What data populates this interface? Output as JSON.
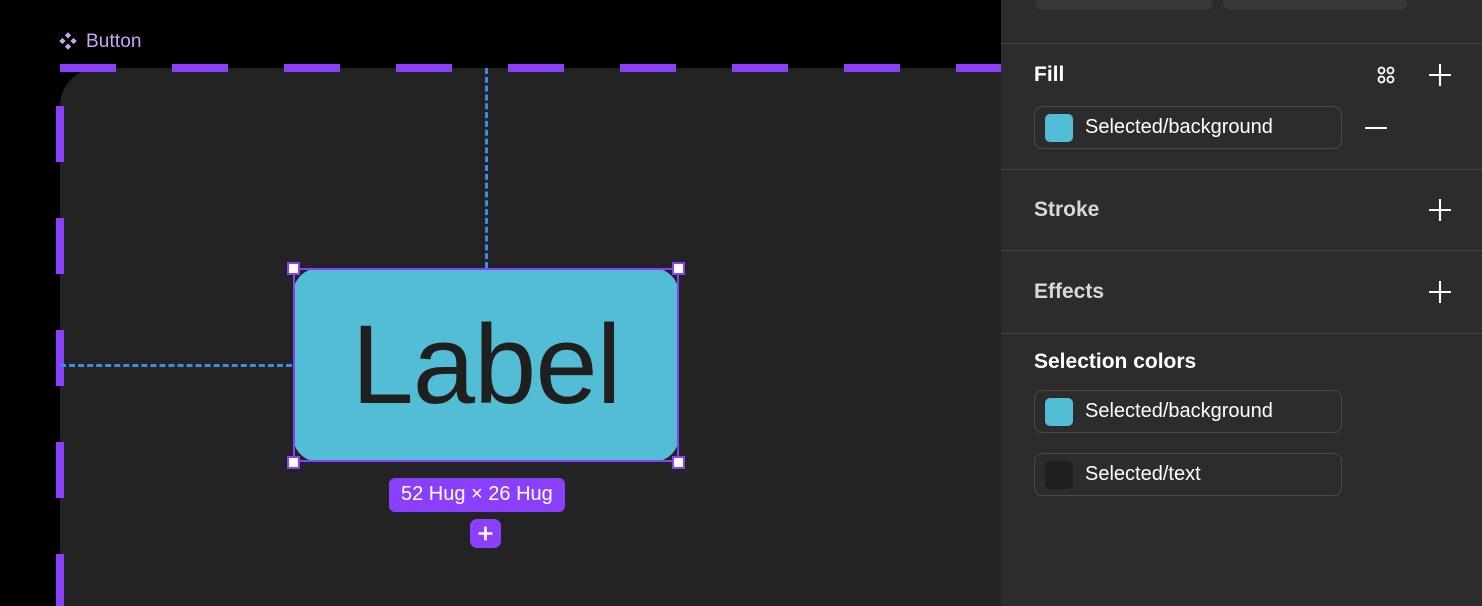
{
  "canvas": {
    "frame": {
      "name": "Button",
      "icon": "component-diamond-icon",
      "accent_color": "#8a3ffc",
      "label_color": "#c9a6f5",
      "background": "#232323"
    },
    "selection": {
      "node_label": "Label",
      "node_fill": "#54bdd6",
      "node_text_color": "#1f1f1f",
      "size_badge": "52 Hug × 26 Hug",
      "badge_color": "#8a3ffc",
      "add_button_icon": "plus-icon",
      "handle_fill": "#ffffff",
      "handle_border": "#8a3ffc"
    },
    "guides": {
      "color": "#3b8ae8",
      "vertical": true,
      "horizontal": true
    }
  },
  "panel": {
    "fill": {
      "title": "Fill",
      "styles_icon": "four-dots-style-icon",
      "add_icon": "plus-icon",
      "items": [
        {
          "label": "Selected/background",
          "color": "#54bdd6",
          "remove_icon": "minus-icon"
        }
      ]
    },
    "stroke": {
      "title": "Stroke",
      "add_icon": "plus-icon"
    },
    "effects": {
      "title": "Effects",
      "add_icon": "plus-icon"
    },
    "selection_colors": {
      "title": "Selection colors",
      "items": [
        {
          "label": "Selected/background",
          "color": "#54bdd6"
        },
        {
          "label": "Selected/text",
          "color": "#1f1f1f"
        }
      ]
    }
  }
}
